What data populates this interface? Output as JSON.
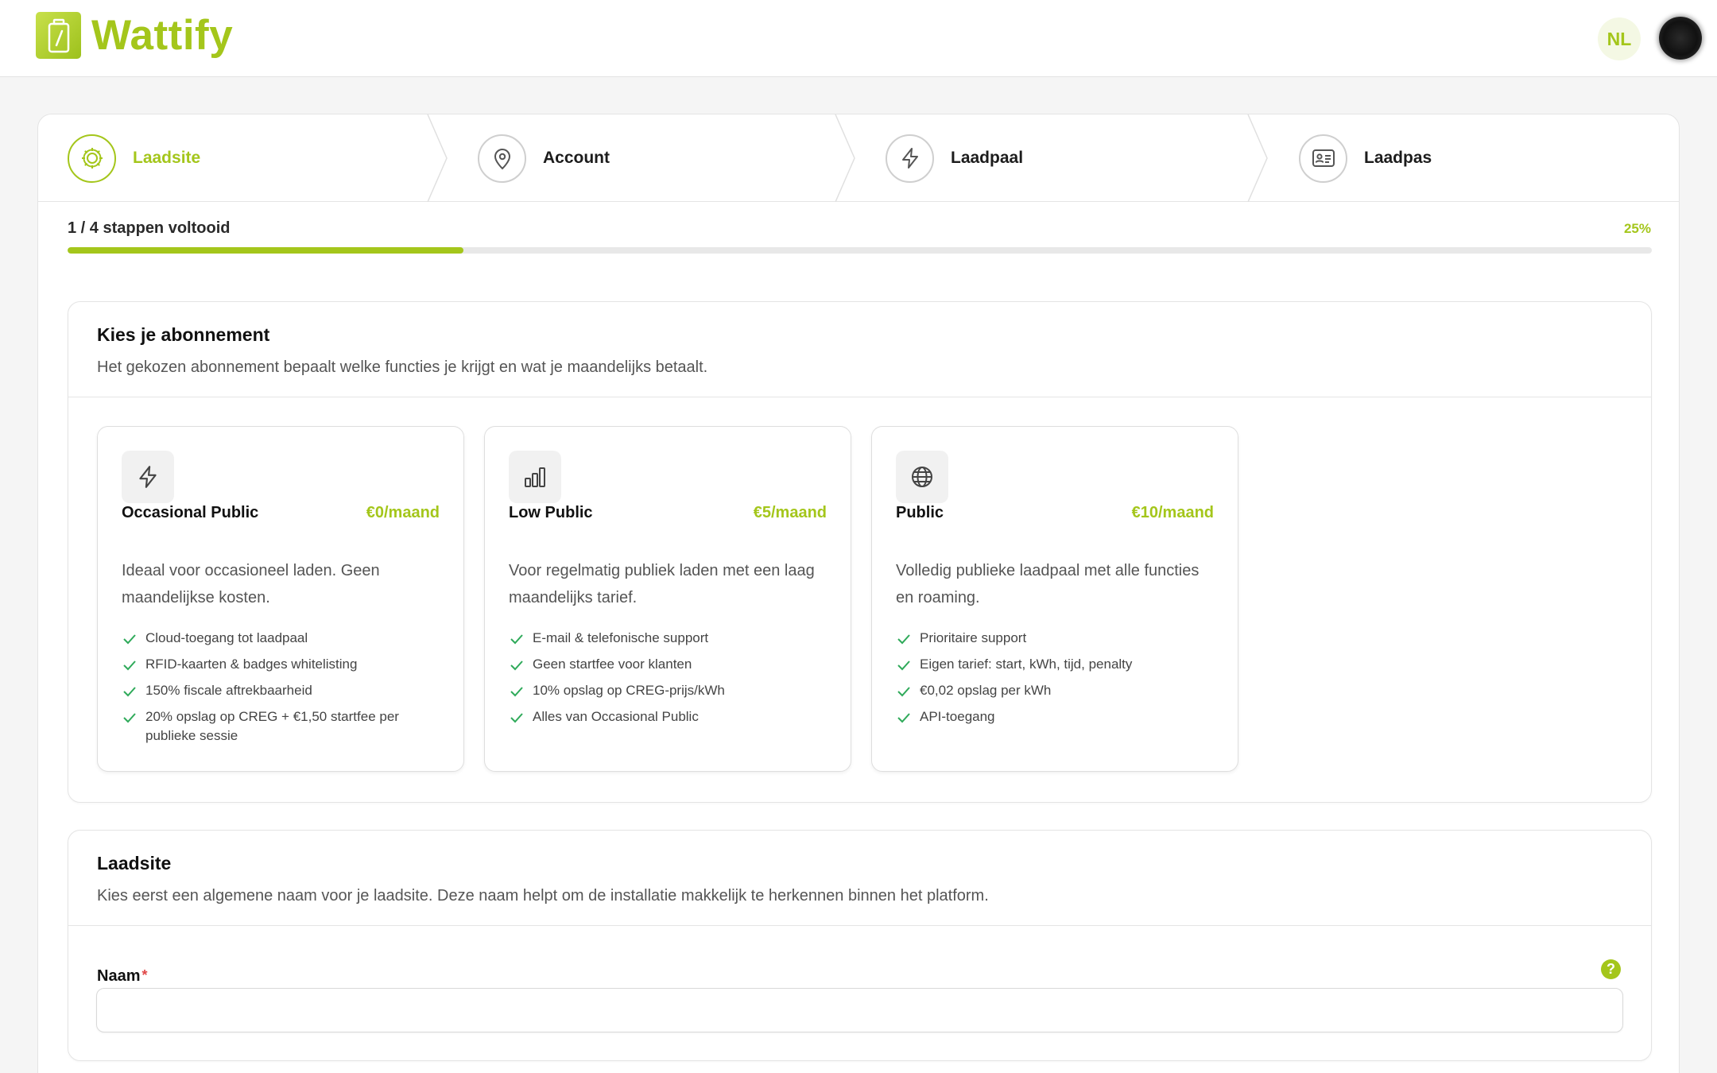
{
  "app": {
    "name": "Wattify",
    "language": "NL"
  },
  "colors": {
    "accent": "#a4c61b",
    "check": "#2faa5a",
    "required": "#e04848"
  },
  "steps": [
    {
      "label": "Laadsite",
      "icon": "gear-icon",
      "active": true
    },
    {
      "label": "Account",
      "icon": "location-pin-icon",
      "active": false
    },
    {
      "label": "Laadpaal",
      "icon": "lightning-icon",
      "active": false
    },
    {
      "label": "Laadpas",
      "icon": "id-card-icon",
      "active": false
    }
  ],
  "progress": {
    "label": "1 / 4 stappen voltooid",
    "percent_label": "25%",
    "fraction": 0.25
  },
  "subscription": {
    "title": "Kies je abonnement",
    "subtitle": "Het gekozen abonnement bepaalt welke functies je krijgt en wat je maandelijks betaalt.",
    "plans": [
      {
        "name": "Occasional Public",
        "price": "€0/maand",
        "icon": "lightning-icon",
        "description": "Ideaal voor occasioneel laden. Geen maandelijkse kosten.",
        "features": [
          "Cloud-toegang tot laadpaal",
          "RFID-kaarten & badges whitelisting",
          "150% fiscale aftrekbaarheid",
          "20% opslag op CREG + €1,50 startfee per publieke sessie"
        ]
      },
      {
        "name": "Low Public",
        "price": "€5/maand",
        "icon": "bar-chart-icon",
        "description": "Voor regelmatig publiek laden met een laag maandelijks tarief.",
        "features": [
          "E-mail & telefonische support",
          "Geen startfee voor klanten",
          "10% opslag op CREG-prijs/kWh",
          "Alles van Occasional Public"
        ]
      },
      {
        "name": "Public",
        "price": "€10/maand",
        "icon": "globe-icon",
        "description": "Volledig publieke laadpaal met alle functies en roaming.",
        "features": [
          "Prioritaire support",
          "Eigen tarief: start, kWh, tijd, penalty",
          "€0,02 opslag per kWh",
          "API-toegang"
        ]
      }
    ]
  },
  "site": {
    "title": "Laadsite",
    "subtitle": "Kies eerst een algemene naam voor je laadsite. Deze naam helpt om de installatie makkelijk te herkennen binnen het platform.",
    "name_label": "Naam",
    "required_mark": "*",
    "help_glyph": "?",
    "name_value": ""
  }
}
